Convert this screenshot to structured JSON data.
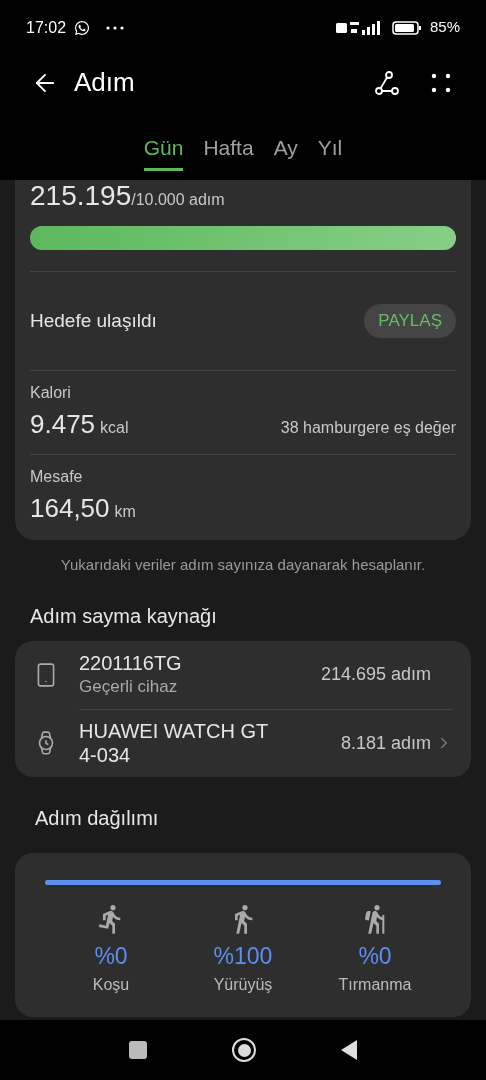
{
  "status_bar": {
    "time": "17:02",
    "battery": "85%"
  },
  "header": {
    "title": "Adım"
  },
  "tabs": [
    {
      "label": "Gün",
      "selected": true
    },
    {
      "label": "Hafta",
      "selected": false
    },
    {
      "label": "Ay",
      "selected": false
    },
    {
      "label": "Yıl",
      "selected": false
    }
  ],
  "summary": {
    "steps": "215.195",
    "goal": "/10.000 adım",
    "level": 1,
    "goal_status": "Hedefe ulaşıldı",
    "share_button": "PAYLAŞ",
    "metrics": [
      {
        "label": "Kalori",
        "value": "9.475",
        "unit": "kcal",
        "note": "38 hamburgere eş değer"
      },
      {
        "label": "Mesafe",
        "value": "164,50",
        "unit": "km"
      }
    ]
  },
  "footnote": "Yukarıdaki veriler adım sayınıza dayanarak hesaplanır.",
  "sources": {
    "title": "Adım sayma kaynağı",
    "items": [
      {
        "kind": "phone",
        "name": "2201116TG",
        "subtitle": "Geçerli cihaz",
        "steps": "214.695 adım",
        "has_arrow": false
      },
      {
        "kind": "watch",
        "name": "HUAWEI WATCH GT 4-034",
        "steps": "8.181 adım",
        "has_arrow": true
      }
    ]
  },
  "distribution": {
    "title": "Adım dağılımı",
    "level": 1,
    "items": [
      {
        "kind": "run",
        "percent": "%0",
        "label": "Koşu"
      },
      {
        "kind": "walk",
        "percent": "%100",
        "label": "Yürüyüş"
      },
      {
        "kind": "climb",
        "percent": "%0",
        "label": "Tırmanma"
      }
    ]
  }
}
